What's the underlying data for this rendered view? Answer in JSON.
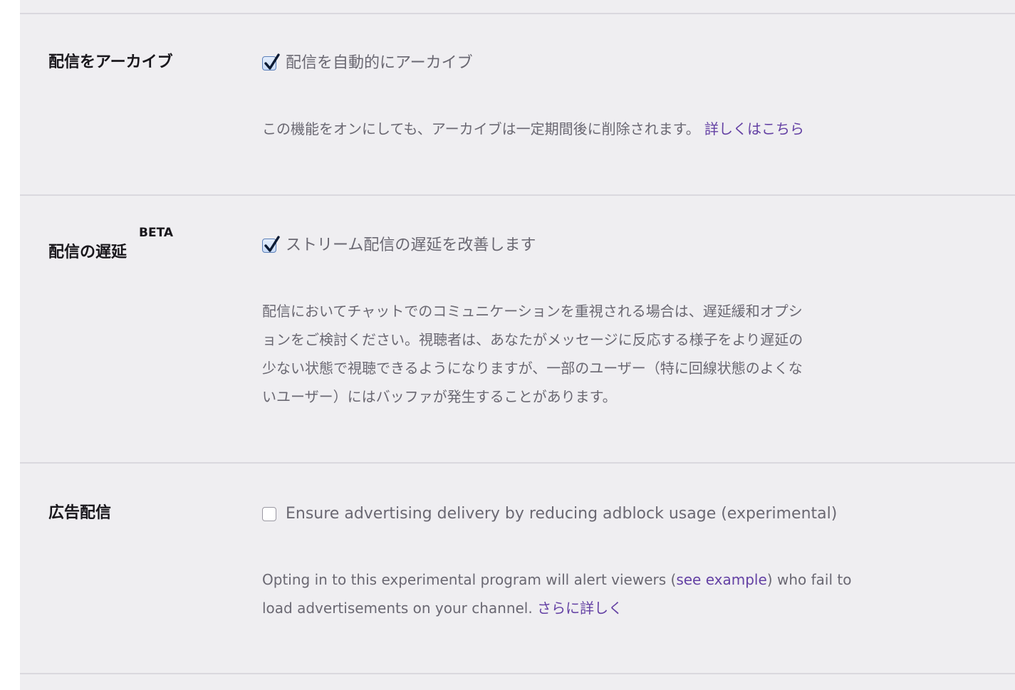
{
  "archive": {
    "label": "配信をアーカイブ",
    "checkbox_label": "配信を自動的にアーカイブ",
    "checked": true,
    "description": "この機能をオンにしても、アーカイブは一定期間後に削除されます。",
    "link_text": "詳しくはこちら"
  },
  "latency": {
    "label": "配信の遅延",
    "badge": "BETA",
    "checkbox_label": "ストリーム配信の遅延を改善します",
    "checked": true,
    "description_lines": [
      "配信においてチャットでのコミュニケーションを重視される場合は、遅延緩和オプシ",
      "ョンをご検討ください。視聴者は、あなたがメッセージに反応する様子をより遅延の",
      "少ない状態で視聴できるようになりますが、一部のユーザー（特に回線状態のよくな",
      "いユーザー）にはバッファが発生することがあります。"
    ]
  },
  "ads": {
    "label": "広告配信",
    "checkbox_label": "Ensure advertising delivery by reducing adblock usage (experimental)",
    "checked": false,
    "description_before": "Opting in to this experimental program will alert viewers (",
    "see_example": "see example",
    "description_middle": ") who fail to",
    "description_line2": "load advertisements on your channel.",
    "link_text": "さらに詳しく"
  },
  "colors": {
    "panel_bg": "#efeef1",
    "link": "#6441a4",
    "text": "#6a6872",
    "heading": "#19171c"
  }
}
